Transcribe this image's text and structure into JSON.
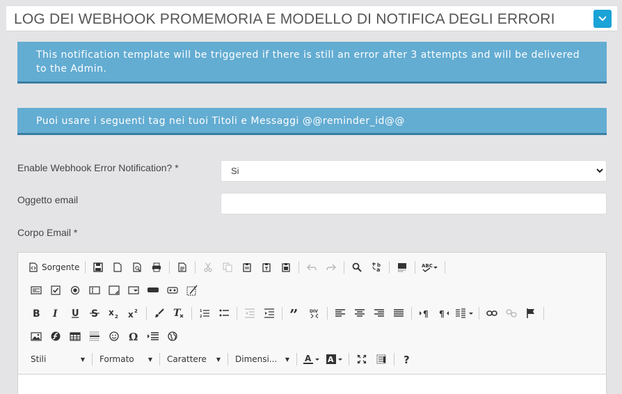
{
  "header": {
    "title": "LOG DEI WEBHOOK PROMEMORIA E MODELLO DI NOTIFICA DEGLI ERRORI"
  },
  "alerts": {
    "notice": "This notification template will be triggered if there is still an error after 3 attempts and will be delivered to the Admin.",
    "tags": "Puoi usare i seguenti tag nei tuoi Titoli e Messaggi @@reminder_id@@"
  },
  "form": {
    "enable_label": "Enable Webhook Error Notification? *",
    "enable_value": "Si",
    "subject_label": "Oggetto email",
    "subject_value": "",
    "body_label": "Corpo Email *"
  },
  "editor": {
    "source_label": "Sorgente",
    "combos": {
      "styles": "Stili",
      "format": "Formato",
      "font": "Carattere",
      "size": "Dimensi..."
    }
  }
}
